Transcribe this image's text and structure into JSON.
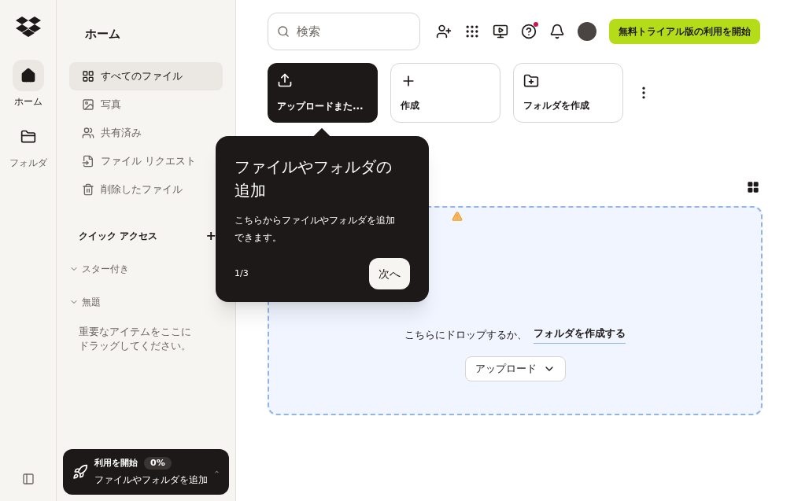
{
  "rail": {
    "items": [
      {
        "label": "ホーム",
        "selected": true
      },
      {
        "label": "フォルダ",
        "selected": false
      }
    ]
  },
  "sidebar": {
    "title": "ホーム",
    "items": [
      {
        "label": "すべてのファイル",
        "selected": true
      },
      {
        "label": "写真",
        "selected": false
      },
      {
        "label": "共有済み",
        "selected": false
      },
      {
        "label": "ファイル リクエスト",
        "selected": false
      },
      {
        "label": "削除したファイル",
        "selected": false
      }
    ],
    "quick_access": {
      "title": "クイック アクセス",
      "add": "+"
    },
    "sections": [
      {
        "label": "スター付き",
        "expanded": true
      },
      {
        "label": "無題",
        "expanded": true
      }
    ],
    "empty_hint": "重要なアイテムをここにドラッグしてください。",
    "progress": {
      "title": "利用を開始",
      "percent": "0%",
      "subtitle": "ファイルやフォルダを追加"
    }
  },
  "topbar": {
    "search": {
      "placeholder": "検索"
    },
    "help_notification": true,
    "trial_button": "無料トライアル版の利用を開始"
  },
  "actions": [
    {
      "label": "アップロードまた...",
      "selected": true
    },
    {
      "label": "作成",
      "selected": false
    },
    {
      "label": "フォルダを作成",
      "selected": false
    }
  ],
  "tooltip": {
    "title": "ファイルやフォルダの追加",
    "body": "こちらからファイルやフォルダを追加できます。",
    "step": "1/3",
    "next": "次へ"
  },
  "dropzone": {
    "text": "こちらにドロップするか、",
    "link": "フォルダを作成する",
    "upload_button": "アップロード"
  }
}
